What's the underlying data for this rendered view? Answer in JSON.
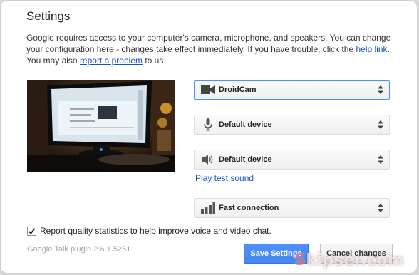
{
  "title": "Settings",
  "description": {
    "part1": "Google requires access to your computer's camera, microphone, and speakers. You can change your configuration here - changes take effect immediately. If you have trouble, click the ",
    "help_link": "help link",
    "part2": ". You may also ",
    "report_link": "report a problem",
    "part3": " to us."
  },
  "devices": {
    "camera": {
      "label": "DroidCam",
      "icon": "camera-icon"
    },
    "microphone": {
      "label": "Default device",
      "icon": "microphone-icon"
    },
    "speaker": {
      "label": "Default device",
      "icon": "speaker-icon"
    },
    "connection": {
      "label": "Fast connection",
      "icon": "signal-bars-icon"
    }
  },
  "play_test_sound": "Play test sound",
  "quality_stats": {
    "label": "Report quality statistics to help improve voice and video chat.",
    "checked": true
  },
  "plugin_version": "Google Talk plugin 2.6.1.5251",
  "buttons": {
    "save": "Save Settings",
    "cancel": "Cancel changes"
  },
  "colors": {
    "accent": "#4d90fe",
    "link": "#1155cc"
  }
}
